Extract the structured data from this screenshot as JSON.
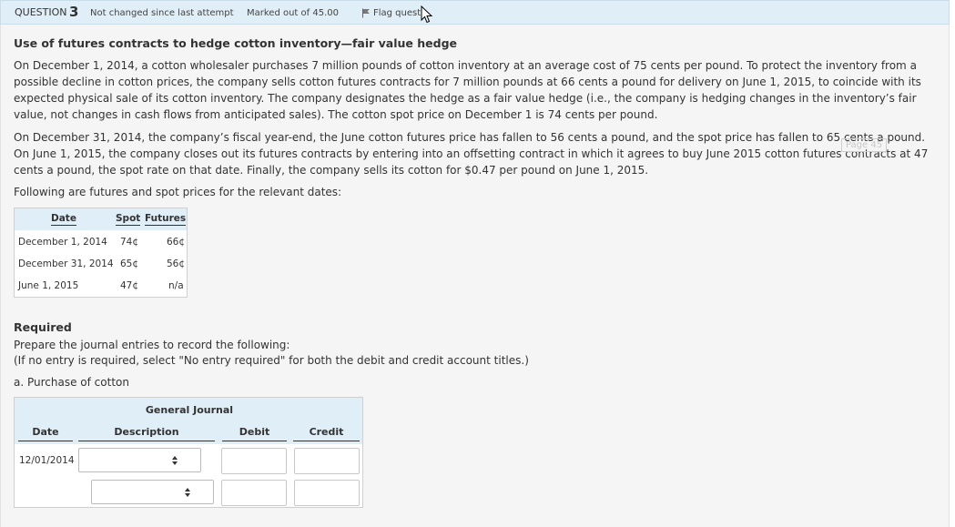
{
  "header": {
    "question_label": "QUESTION",
    "question_number": "3",
    "status": "Not changed since last attempt",
    "marks": "Marked out of 45.00",
    "flag_label": "Flag questi"
  },
  "question": {
    "title": "Use of futures contracts to hedge cotton inventory—fair value hedge",
    "paragraph1": "On December 1, 2014, a cotton wholesaler purchases 7 million pounds of cotton inventory at an average cost of 75 cents per pound. To protect the inventory from a possible decline in cotton prices, the company sells cotton futures contracts for 7 million pounds at 66 cents a pound for delivery on June 1, 2015, to coincide with its expected physical sale of its cotton inventory. The company designates the hedge as a fair value hedge (i.e., the company is hedging changes in the inventory’s fair value, not changes in cash flows from anticipated sales). The cotton spot price on December 1 is 74 cents per pound.",
    "paragraph2": "On December 31, 2014, the company’s fiscal year-end, the June cotton futures price has fallen to 56 cents a pound, and the spot price has fallen to 65 cents a pound. On June 1, 2015, the company closes out its futures contracts by entering into an offsetting contract in which it agrees to buy June 2015 cotton futures contracts at 47 cents a pound, the spot rate on that date. Finally, the company sells its cotton for $0.47 per pound on June 1, 2015.",
    "paragraph3": "Following are futures and spot prices for the relevant dates:",
    "watermark": "Page 45"
  },
  "price_table": {
    "headers": [
      "Date",
      "Spot",
      "Futures"
    ],
    "rows": [
      {
        "date": "December 1, 2014",
        "spot": "74¢",
        "futures": "66¢"
      },
      {
        "date": "December 31, 2014",
        "spot": "65¢",
        "futures": "56¢"
      },
      {
        "date": "June 1, 2015",
        "spot": "47¢",
        "futures": "n/a"
      }
    ]
  },
  "required": {
    "title": "Required",
    "line1": "Prepare the journal entries to record the following:",
    "line2": "(If no entry is required, select \"No entry required\" for both the debit and credit account titles.)",
    "part_a": "a. Purchase of cotton"
  },
  "journal": {
    "title": "General Journal",
    "columns": [
      "Date",
      "Description",
      "Debit",
      "Credit"
    ],
    "row_date": "12/01/2014",
    "select1_value": "",
    "select2_value": "",
    "debit1": "",
    "credit1": "",
    "debit2": "",
    "credit2": ""
  },
  "icons": {
    "flag": "flag-icon",
    "cursor": "mouse-pointer-icon",
    "select_arrows": "select-arrows-icon"
  }
}
